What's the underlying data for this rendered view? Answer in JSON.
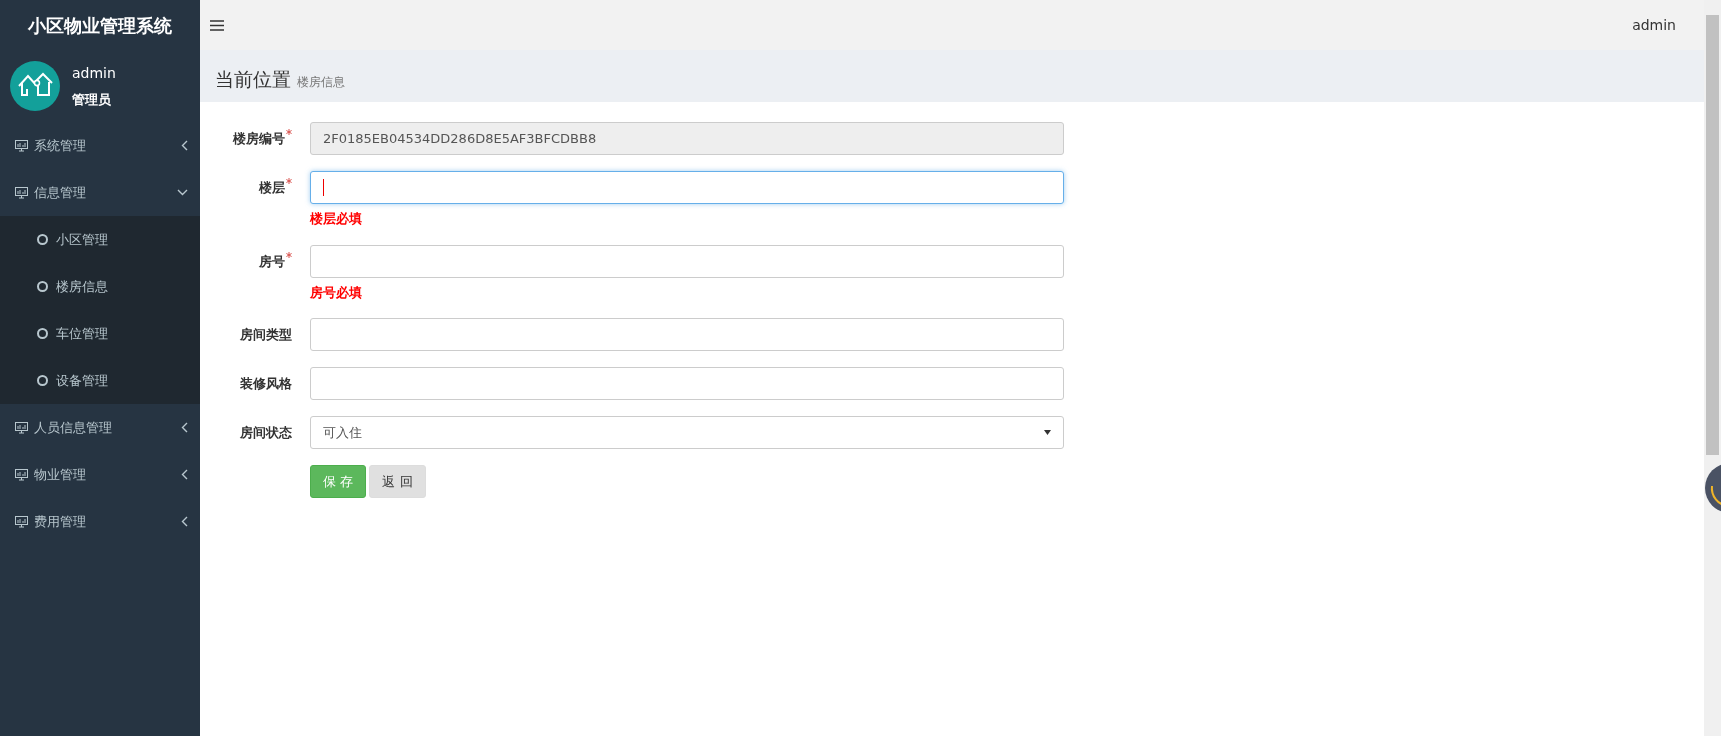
{
  "sidebar": {
    "title": "小区物业管理系统",
    "user": {
      "name": "admin",
      "role": "管理员"
    },
    "menu": [
      {
        "label": "系统管理",
        "expanded": false
      },
      {
        "label": "信息管理",
        "expanded": true,
        "children": [
          {
            "label": "小区管理"
          },
          {
            "label": "楼房信息"
          },
          {
            "label": "车位管理"
          },
          {
            "label": "设备管理"
          }
        ]
      },
      {
        "label": "人员信息管理",
        "expanded": false
      },
      {
        "label": "物业管理",
        "expanded": false
      },
      {
        "label": "费用管理",
        "expanded": false
      }
    ]
  },
  "topbar": {
    "user": "admin"
  },
  "breadcrumb": {
    "title": "当前位置",
    "current": "楼房信息"
  },
  "form": {
    "fields": [
      {
        "kind": "text",
        "label": "楼房编号",
        "required": true,
        "disabled": true,
        "focused": false,
        "value": "2F0185EB04534DD286D8E5AF3BFCDBB8"
      },
      {
        "kind": "text",
        "label": "楼层",
        "required": true,
        "disabled": false,
        "focused": true,
        "error": "楼层必填"
      },
      {
        "kind": "text",
        "label": "房号",
        "required": true,
        "disabled": false,
        "focused": false,
        "error": "房号必填"
      },
      {
        "kind": "text",
        "label": "房间类型",
        "required": false,
        "disabled": false,
        "focused": false
      },
      {
        "kind": "text",
        "label": "装修风格",
        "required": false,
        "disabled": false,
        "focused": false
      },
      {
        "kind": "select",
        "label": "房间状态",
        "required": false,
        "disabled": false,
        "focused": false,
        "value": "可入住"
      }
    ],
    "buttons": [
      {
        "label": "保 存",
        "kind": "primary"
      },
      {
        "label": "返 回",
        "kind": "secondary"
      }
    ]
  }
}
